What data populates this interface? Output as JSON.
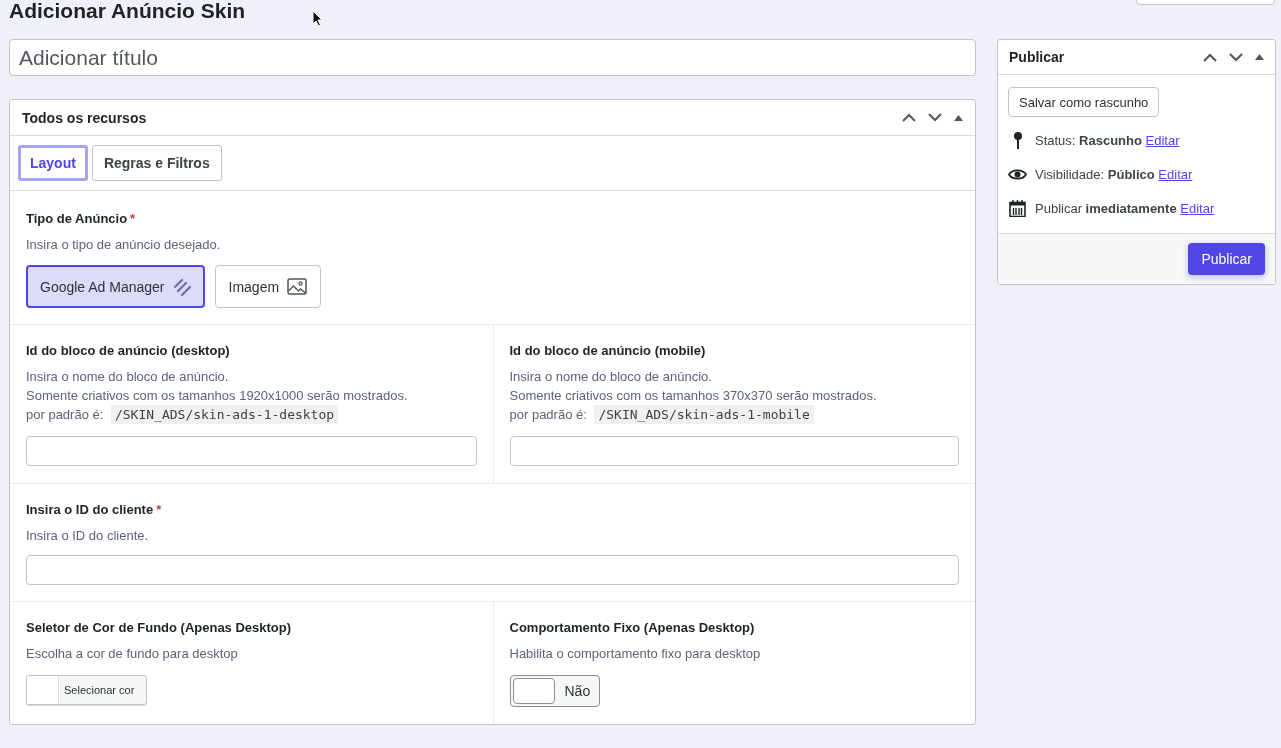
{
  "page_title": "Adicionar Anúncio Skin",
  "title_field": {
    "placeholder": "Adicionar título"
  },
  "resources_panel": {
    "title": "Todos os recursos",
    "tabs": [
      {
        "label": "Layout",
        "selected": true
      },
      {
        "label": "Regras e Filtros",
        "selected": false
      }
    ],
    "ad_type": {
      "label": "Tipo de Anúncio",
      "required_mark": "*",
      "hint": "Insira o tipo de anúncio desejado.",
      "options": [
        {
          "label": "Google Ad Manager",
          "kind": "gam",
          "selected": true
        },
        {
          "label": "Imagem",
          "kind": "image",
          "selected": false
        }
      ]
    },
    "ad_unit_fields": [
      {
        "label": "Id do bloco de anúncio (desktop)",
        "hint_lines": [
          "Insira o nome do bloco de anúncio.",
          "Somente criativos com os tamanhos 1920x1000 serão mostrados."
        ],
        "default_label": "por padrão é:",
        "default_value": "/SKIN_ADS/skin-ads-1-desktop"
      },
      {
        "label": "Id do bloco de anúncio (mobile)",
        "hint_lines": [
          "Insira o nome do bloco de anúncio.",
          "Somente criativos com os tamanhos 370x370 serão mostrados."
        ],
        "default_label": "por padrão é:",
        "default_value": "/SKIN_ADS/skin-ads-1-mobile"
      }
    ],
    "client_id": {
      "label": "Insira o ID do cliente",
      "required_mark": "*",
      "hint": "Insira o ID do cliente."
    },
    "background_color": {
      "label": "Seletor de Cor de Fundo (Apenas Desktop)",
      "hint": "Escolha a cor de fundo para desktop",
      "button": "Selecionar cor"
    },
    "sticky": {
      "label": "Comportamento Fixo (Apenas Desktop)",
      "hint": "Habilita o comportamento fixo para desktop",
      "on": false,
      "state_text": "Não"
    }
  },
  "publish_box": {
    "title": "Publicar",
    "save_draft": "Salvar como rascunho",
    "rows": [
      {
        "kind": "status",
        "text": "Status: **Rascunho**",
        "link": "Editar"
      },
      {
        "kind": "visibility",
        "text": "Visibilidade: **Público**",
        "link": "Editar"
      },
      {
        "kind": "schedule",
        "text": "Publicar **imediatamente**",
        "link": "Editar"
      }
    ],
    "publish_button": "Publicar"
  }
}
